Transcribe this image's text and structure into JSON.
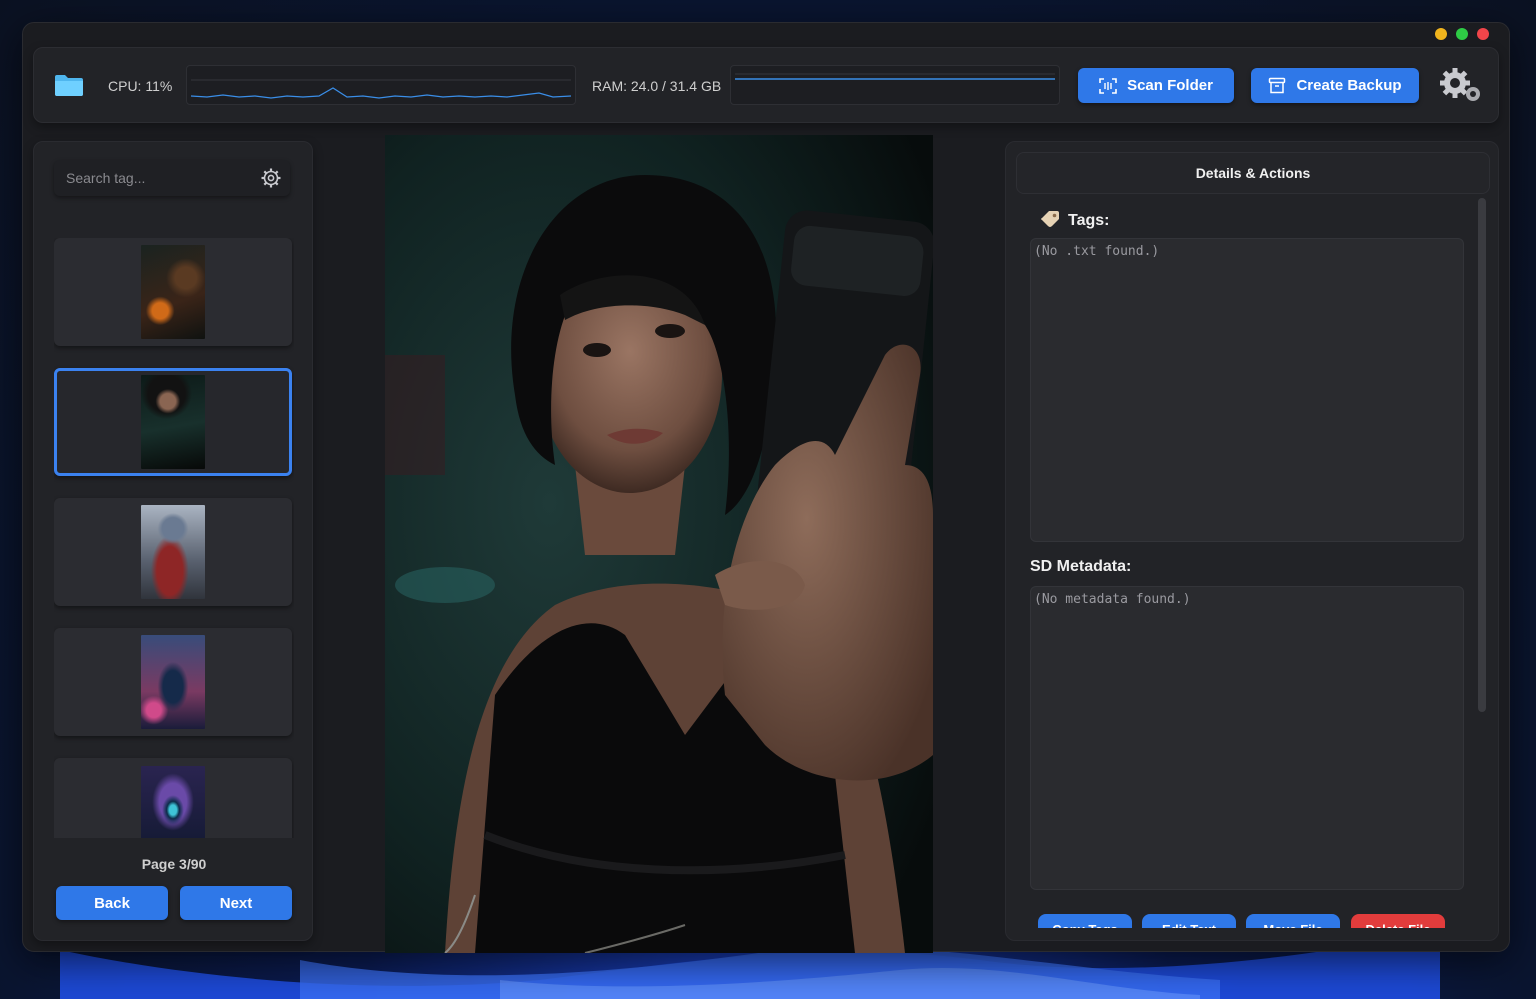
{
  "window": {
    "controls": [
      "minimize",
      "maximize",
      "close"
    ],
    "colors": {
      "minimize": "#f0b41d",
      "maximize": "#2ecb45",
      "close": "#f1454a"
    }
  },
  "toolbar": {
    "folder_icon": "folder-icon",
    "cpu_label": "CPU: 11%",
    "ram_label": "RAM: 24.0 / 31.4 GB",
    "scan_label": "Scan Folder",
    "scan_icon": "scan-icon",
    "backup_label": "Create Backup",
    "backup_icon": "archive-icon",
    "settings_icon": "gears-icon",
    "accent": "#2f78e8"
  },
  "sidebar": {
    "search_placeholder": "Search tag...",
    "search_icon": "gear-icon",
    "thumbnails": [
      {
        "description": "pumpkin",
        "selected": false
      },
      {
        "description": "woman-selfie",
        "selected": true
      },
      {
        "description": "robot-red-coat",
        "selected": false
      },
      {
        "description": "robot-city-night",
        "selected": false
      },
      {
        "description": "eye-closeup",
        "selected": false
      }
    ],
    "page_label": "Page 3/90",
    "back_label": "Back",
    "next_label": "Next"
  },
  "details": {
    "header": "Details & Actions",
    "tags_label": "Tags:",
    "tags_icon": "tag-icon",
    "tags_value": "(No .txt found.)",
    "metadata_label": "SD Metadata:",
    "metadata_value": "(No metadata found.)",
    "actions": [
      {
        "label": "Copy Tags",
        "color": "#2f78e8"
      },
      {
        "label": "Edit Text",
        "color": "#2f78e8"
      },
      {
        "label": "Move File",
        "color": "#2f78e8"
      },
      {
        "label": "Delete File",
        "color": "#e23c3c"
      }
    ]
  }
}
